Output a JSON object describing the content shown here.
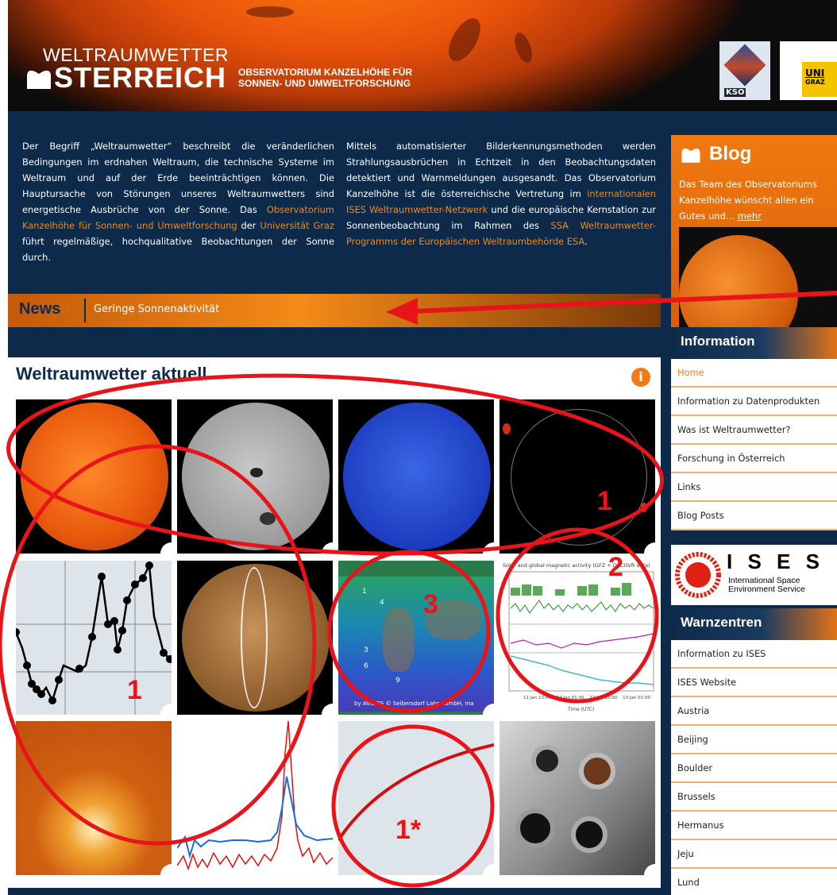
{
  "header": {
    "brand_line1": "WELTRAUMWETTER",
    "brand_line2": "STERREICH",
    "subtitle_line1": "OBSERVATORIUM KANZELHÖHE FÜR",
    "subtitle_line2": "SONNEN- UND UMWELTFORSCHUNG",
    "logo_kso": "KSO",
    "logo_uni_line1": "UNI",
    "logo_uni_line2": "GRAZ"
  },
  "intro": {
    "col1": {
      "p1": "Der Begriff „Weltraumwetter“ beschreibt die veränderlichen Bedingungen im erdnahen Weltraum, die technische Systeme im Weltraum und auf der Erde beeinträchtigen können. Die Hauptursache von Störungen unseres Weltraumwetters sind energetische Ausbrüche von der Sonne. Das ",
      "link1": "Observatorium Kanzelhöhe für Sonnen- und Umweltforschung",
      "p2": " der ",
      "link2": "Universität Graz",
      "p3": " führt regelmäßige, hochqualitative Beobachtungen der Sonne durch."
    },
    "col2": {
      "p1": "Mittels automatisierter Bilderkennungsmethoden werden Strahlungsausbrüchen in Echtzeit in den Beobachtungsdaten detektiert und Warnmeldungen ausgesandt. Das Observatorium Kanzelhöhe ist die österreichische Vertretung im ",
      "link1": "internationalen ISES Weltraumwetter-Netzwerk",
      "p2": " und die europäische Kernstation zur Sonnenbeobachtung im Rahmen des ",
      "link2": "SSA Weltraumwetter-Programms der Europäischen Weltraumbehörde ESA",
      "p3": "."
    }
  },
  "news": {
    "label": "News",
    "text": "Geringe Sonnenaktivität"
  },
  "panel": {
    "title": "Weltraumwetter aktuell",
    "info_icon": "info-icon"
  },
  "tiles": {
    "t10_caption": "Solar and global magnetic activity (GFZ + DSCOVR data)",
    "t10_xlabel": "Time (UTC)",
    "t10_ticks": [
      "11 Jan 13:00",
      "12 Jan 01:00",
      "12 Jan 13:00",
      "13 Jan 01:00"
    ],
    "t9_credit": "by AVIDOS © Seibersdorf Labor GmbH, ma",
    "t9_labels": [
      "4",
      "3",
      "6",
      "9",
      "1"
    ]
  },
  "blog": {
    "title": "Blog",
    "text": "Das Team des Observatoriums Kanzelhöhe wünscht allen ein Gutes und…",
    "more": "mehr"
  },
  "information": {
    "title": "Information",
    "items": [
      "Home",
      "Information zu Datenprodukten",
      "Was ist Weltraumwetter?",
      "Forschung in Österreich",
      "Links",
      "Blog Posts"
    ]
  },
  "ises": {
    "letters": "I S E S",
    "line1": "International Space",
    "line2": "Environment Service"
  },
  "warnzentren": {
    "title": "Warnzentren",
    "items": [
      "Information zu ISES",
      "ISES Website",
      "Austria",
      "Beijing",
      "Boulder",
      "Brussels",
      "Hermanus",
      "Jeju",
      "Lund"
    ]
  },
  "annotations": {
    "n1a": "1",
    "n1b": "1",
    "n2": "2",
    "n3": "3",
    "n1star": "1*"
  },
  "colors": {
    "accent": "#f07a18",
    "navy": "#0d2a4a",
    "annotation": "#e8141a"
  }
}
